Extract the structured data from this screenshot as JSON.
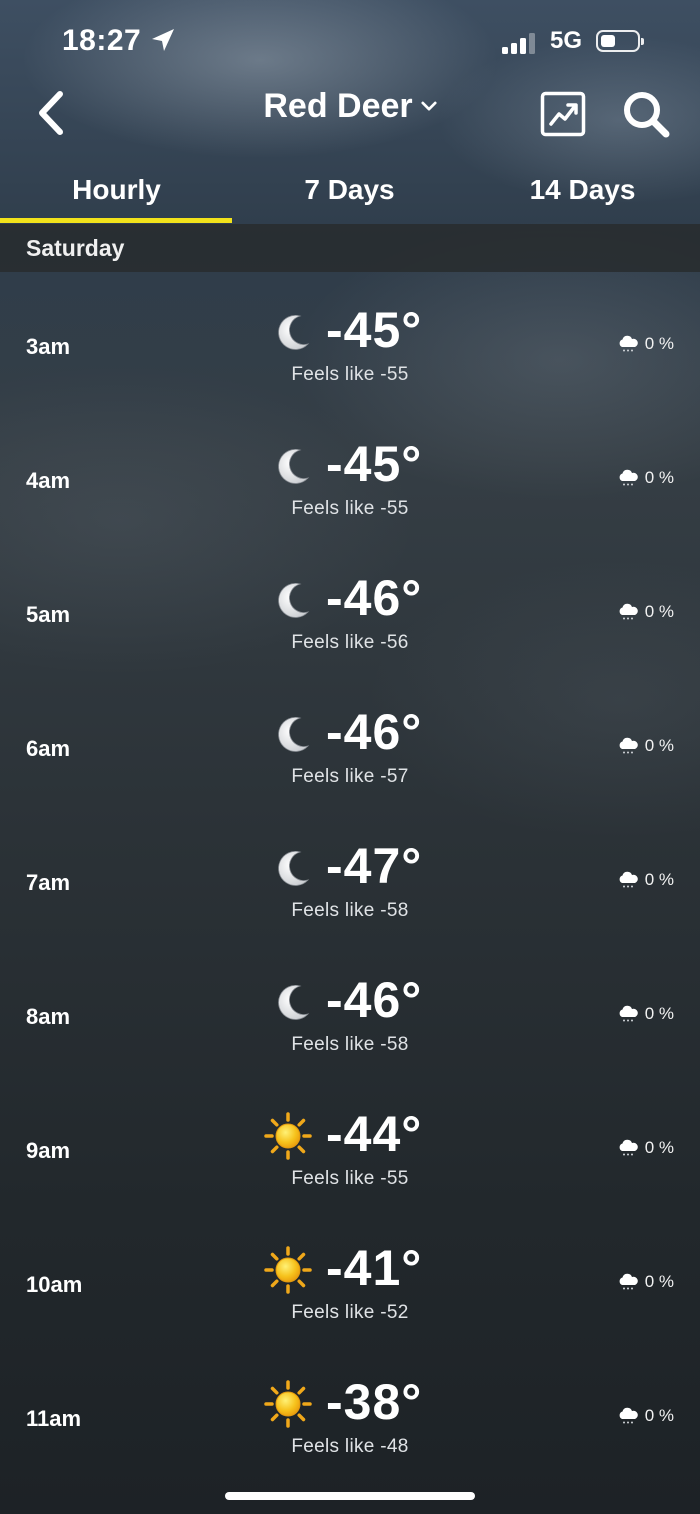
{
  "status_bar": {
    "time": "18:27",
    "network": "5G",
    "location_icon": "location-arrow-icon",
    "signal_icon": "cellular-signal-icon",
    "battery_icon": "battery-icon"
  },
  "header": {
    "city": "Red Deer",
    "back_icon": "chevron-left-icon",
    "dropdown_icon": "chevron-down-icon",
    "chart_icon": "trend-chart-icon",
    "search_icon": "search-icon"
  },
  "tabs": [
    {
      "label": "Hourly",
      "active": true
    },
    {
      "label": "7 Days",
      "active": false
    },
    {
      "label": "14 Days",
      "active": false
    }
  ],
  "accent_color": "#f2e21b",
  "day_label": "Saturday",
  "hours": [
    {
      "time": "3am",
      "icon": "moon-icon",
      "temp": "-45°",
      "feels": "Feels like -55",
      "precip": "0 %"
    },
    {
      "time": "4am",
      "icon": "moon-icon",
      "temp": "-45°",
      "feels": "Feels like -55",
      "precip": "0 %"
    },
    {
      "time": "5am",
      "icon": "moon-icon",
      "temp": "-46°",
      "feels": "Feels like -56",
      "precip": "0 %"
    },
    {
      "time": "6am",
      "icon": "moon-icon",
      "temp": "-46°",
      "feels": "Feels like -57",
      "precip": "0 %"
    },
    {
      "time": "7am",
      "icon": "moon-icon",
      "temp": "-47°",
      "feels": "Feels like -58",
      "precip": "0 %"
    },
    {
      "time": "8am",
      "icon": "moon-icon",
      "temp": "-46°",
      "feels": "Feels like -58",
      "precip": "0 %"
    },
    {
      "time": "9am",
      "icon": "sun-icon",
      "temp": "-44°",
      "feels": "Feels like -55",
      "precip": "0 %"
    },
    {
      "time": "10am",
      "icon": "sun-icon",
      "temp": "-41°",
      "feels": "Feels like -52",
      "precip": "0 %"
    },
    {
      "time": "11am",
      "icon": "sun-icon",
      "temp": "-38°",
      "feels": "Feels like -48",
      "precip": "0 %"
    }
  ]
}
